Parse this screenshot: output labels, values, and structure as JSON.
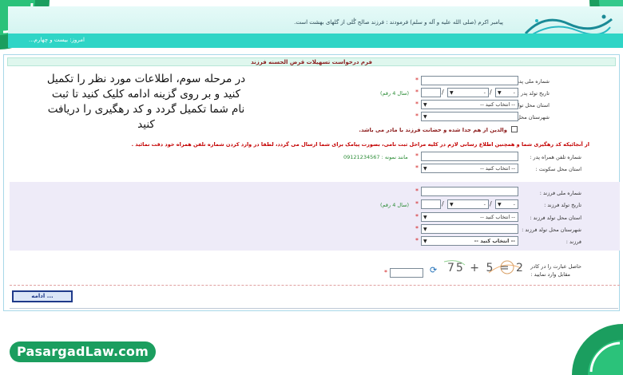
{
  "header": {
    "hadith": "پیامبر اکرم (صلی الله علیه و آله و سلم) فرمودند : فرزند صالح گُلی از گلهای بهشت است.",
    "logo_text": "تحریر الحسنه فرزند",
    "date": "امروز: بیست و چهارم..."
  },
  "form": {
    "title": "فرم درخواست تسهیلات قرض الحسنه فرزند",
    "father": {
      "national_id_label": "شماره ملی پدر :",
      "birth_date_label": "تاریخ تولد پدر :",
      "year_hint": "(سال 4 رقم)",
      "birth_province_label": "استان محل تولد پدر :",
      "birth_city_label": "شهرستان محل تولد پدر :",
      "province_placeholder": "-- انتخاب کنید --",
      "day_value": "-",
      "month_value": "-"
    },
    "deceased_check_label": "والدین از هم جدا شده و حضانت فرزند با مادر می باشد.",
    "notice": "از آنجائیکه کد رهگیری شما و همچنین اطلاع رسانی لازم در کلیه مراحل ثبت نامی، بصورت پیامک برای شما ارسال می گردد، لطفا در وارد کردن شماره تلفن همراه خود دقت نمائید .",
    "mobile_label": "شماره تلفن همراه پدر :",
    "mobile_hint": "مانند نمونه : 09121234567",
    "residence_province_label": "استان محل سکونت :",
    "residence_placeholder": "-- انتخاب کنید --",
    "child": {
      "national_id_label": "شماره ملی فرزند :",
      "birth_date_label": "تاریخ تولد فرزند :",
      "year_hint": "(سال 4 رقم)",
      "birth_province_label": "استان محل تولد فرزند :",
      "birth_city_label": "شهرستان محل تولد فرزند :",
      "child_label": "فرزند :",
      "province_placeholder": "-- انتخاب کنید --",
      "child_placeholder": "-- انتخاب کنید --",
      "day_value": "-",
      "month_value": "-"
    },
    "captcha": {
      "label_line1": "حاصل عبارت را در کادر",
      "label_line2": "مقابل وارد نمایید :",
      "expression": "75 + 5 = 2",
      "refresh_icon": "refresh-icon"
    },
    "continue_label": "ادامه ..."
  },
  "overlay_note": "در مرحله سوم، اطلاعات مورد نظر را تکمیل کنید و بر روی گزینه ادامه کلیک کنید تا ثبت نام شما تکمیل گردد و کد رهگیری را دریافت کنید",
  "brand": "PasargadLaw.com",
  "required_mark": "*",
  "colors": {
    "accent": "#2fd5c6",
    "brand_green": "#1b9e5f",
    "required": "#d21f1f"
  }
}
